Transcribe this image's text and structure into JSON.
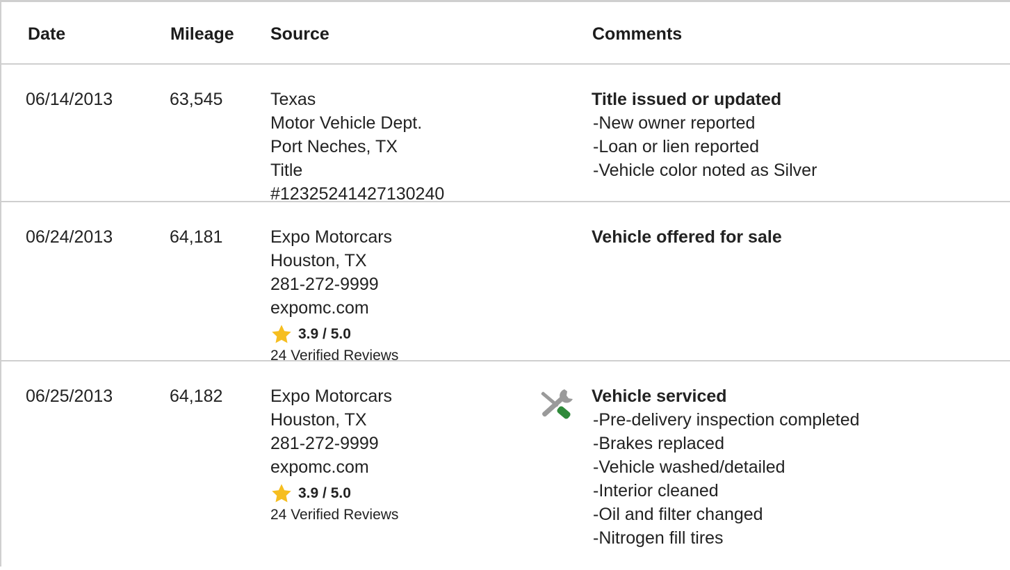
{
  "columns": {
    "date": "Date",
    "mileage": "Mileage",
    "source": "Source",
    "comments": "Comments"
  },
  "records": [
    {
      "date": "06/14/2013",
      "mileage": "63,545",
      "source": [
        "Texas",
        "Motor Vehicle Dept.",
        "Port Neches, TX",
        "Title",
        "#12325241427130240"
      ],
      "comment_title": "Title issued or updated",
      "comment_items": [
        "New owner reported",
        "Loan or lien reported",
        "Vehicle color noted as Silver"
      ]
    },
    {
      "date": "06/24/2013",
      "mileage": "64,181",
      "source": [
        "Expo Motorcars",
        "Houston, TX",
        "281-272-9999",
        "expomc.com"
      ],
      "rating": "3.9 / 5.0",
      "rating_value": 3.9,
      "reviews": "24 Verified Reviews",
      "comment_title": "Vehicle offered for sale",
      "comment_items": []
    },
    {
      "date": "06/25/2013",
      "mileage": "64,182",
      "source": [
        "Expo Motorcars",
        "Houston, TX",
        "281-272-9999",
        "expomc.com"
      ],
      "rating": "3.9 / 5.0",
      "rating_value": 3.9,
      "reviews": "24 Verified Reviews",
      "icon": "service-tools-icon",
      "comment_title": "Vehicle serviced",
      "comment_items": [
        "Pre-delivery inspection completed",
        "Brakes replaced",
        "Vehicle washed/detailed",
        "Interior cleaned",
        "Oil and filter changed",
        "Nitrogen fill tires"
      ]
    }
  ],
  "bullet_prefix": "-",
  "colors": {
    "star": "#f6be20",
    "wrench": "#9a9a9a",
    "screwdriver_handle": "#2f8a3a",
    "border": "#cfcfcf"
  }
}
